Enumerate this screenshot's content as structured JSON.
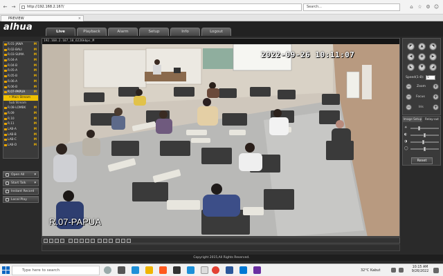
{
  "browser": {
    "url": "http://192.168.2.167/",
    "search_placeholder": "Search...",
    "tab_title": "PREVIEW"
  },
  "app": {
    "logo": "alhua",
    "tabs": [
      {
        "label": "Live",
        "active": true
      },
      {
        "label": "Playback"
      },
      {
        "label": "Alarm"
      },
      {
        "label": "Setup"
      },
      {
        "label": "Info"
      },
      {
        "label": "Logout"
      }
    ]
  },
  "channels": [
    {
      "label": "R.01-JAWA",
      "flag": "M"
    },
    {
      "label": "R.02-BALI",
      "flag": "M"
    },
    {
      "label": "R.03-SUMA",
      "flag": "M"
    },
    {
      "label": "R.04-A",
      "flag": "M"
    },
    {
      "label": "R.04-B",
      "flag": "M"
    },
    {
      "label": "R.05-A",
      "flag": "M"
    },
    {
      "label": "R.05-B",
      "flag": "M"
    },
    {
      "label": "R.06-A",
      "flag": "M"
    },
    {
      "label": "R.06-B",
      "flag": "M"
    },
    {
      "label": "R.07-PAPUA",
      "flag": "M",
      "active": true
    },
    {
      "label": "• Main Stream",
      "stream": true
    },
    {
      "label": "Sub Stream",
      "substream": true
    },
    {
      "label": "R.08-LOMBK",
      "flag": "M"
    },
    {
      "label": "R.09",
      "flag": "M"
    },
    {
      "label": "R.10",
      "flag": "M"
    },
    {
      "label": "R.11",
      "flag": "M"
    },
    {
      "label": "LAB-A",
      "flag": "M"
    },
    {
      "label": "LAB-B",
      "flag": "M"
    },
    {
      "label": "LAB-C",
      "flag": "M"
    },
    {
      "label": "LAB-D",
      "flag": "M"
    }
  ],
  "side_buttons": {
    "open_all": "Open All",
    "start_talk": "Start Talk",
    "instant_record": "Instant Record",
    "local_play": "Local Play"
  },
  "video": {
    "info": "192.168.2.167_10_6226kbps_M",
    "timestamp": "2022-09-26 10:11:07",
    "room_label": "R.07-PAPUA"
  },
  "ptz": {
    "speed_label": "Speed(1-8):",
    "speed_value": "5",
    "zoom": "Zoom",
    "focus": "Focus",
    "iris": "Iris"
  },
  "image_panel": {
    "tab_setup": "Image Setup",
    "tab_relay": "Relay-out",
    "sliders": [
      {
        "icon": "brightness-icon",
        "level": 0.3
      },
      {
        "icon": "contrast-icon",
        "level": 0.5
      },
      {
        "icon": "saturation-icon",
        "level": 0.45
      },
      {
        "icon": "hue-icon",
        "level": 0.5
      }
    ],
    "reset": "Reset"
  },
  "footer": {
    "copyright": "Copyright 2015,All Rights Reserved."
  },
  "taskbar": {
    "search_placeholder": "Type here to search",
    "weather": "32°C  Kabut",
    "time": "10:15 AM",
    "date": "9/26/2022"
  },
  "colors": {
    "accent": "#f0c000",
    "chrome": "#2b2b2b"
  }
}
